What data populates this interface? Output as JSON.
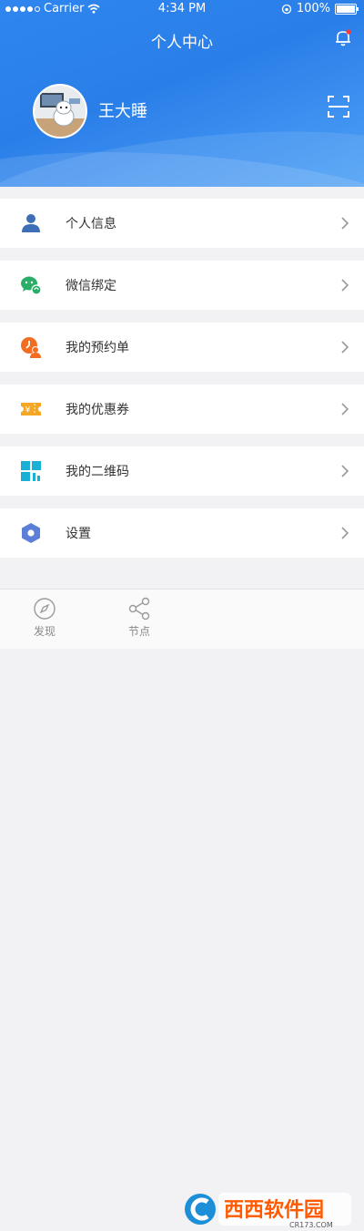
{
  "status_bar": {
    "carrier": "Carrier",
    "time": "4:34 PM",
    "battery": "100%"
  },
  "header": {
    "title": "个人中心",
    "username": "王大睡"
  },
  "menu": [
    {
      "label": "个人信息",
      "icon": "person-icon",
      "color": "#3d6fb6"
    },
    {
      "label": "微信绑定",
      "icon": "wechat-icon",
      "color": "#2aae67"
    },
    {
      "label": "我的预约单",
      "icon": "appointment-icon",
      "color": "#f26d21"
    },
    {
      "label": "我的优惠券",
      "icon": "coupon-icon",
      "color": "#f5a623"
    },
    {
      "label": "我的二维码",
      "icon": "qrcode-icon",
      "color": "#1ab0d6"
    },
    {
      "label": "设置",
      "icon": "settings-icon",
      "color": "#5b7fd6"
    }
  ],
  "tabbar": [
    {
      "label": "发现",
      "icon": "compass-icon"
    },
    {
      "label": "节点",
      "icon": "nodes-icon"
    }
  ],
  "watermark": {
    "text": "西西软件园",
    "sub": "CR173.COM"
  }
}
